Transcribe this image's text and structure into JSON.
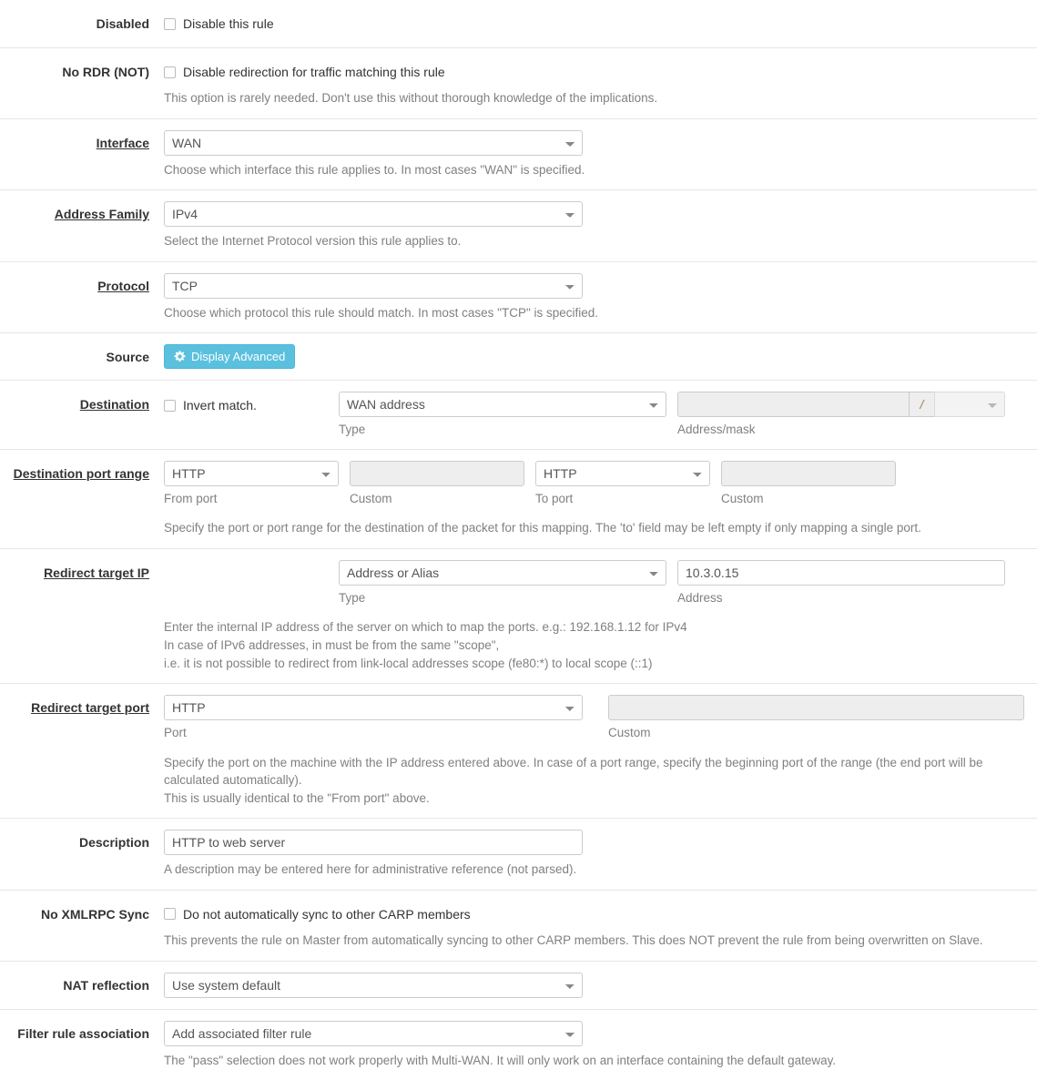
{
  "rows": {
    "disabled": {
      "label": "Disabled",
      "checkbox_label": "Disable this rule",
      "checked": false
    },
    "no_rdr": {
      "label": "No RDR (NOT)",
      "checkbox_label": "Disable redirection for traffic matching this rule",
      "checked": false,
      "help": "This option is rarely needed. Don't use this without thorough knowledge of the implications."
    },
    "interface": {
      "label": "Interface",
      "value": "WAN",
      "help": "Choose which interface this rule applies to. In most cases \"WAN\" is specified."
    },
    "address_family": {
      "label": "Address Family",
      "value": "IPv4",
      "help": "Select the Internet Protocol version this rule applies to."
    },
    "protocol": {
      "label": "Protocol",
      "value": "TCP",
      "help": "Choose which protocol this rule should match. In most cases \"TCP\" is specified."
    },
    "source": {
      "label": "Source",
      "button_label": "Display Advanced",
      "button_icon": "gear-icon",
      "button_color": "#5bc0de"
    },
    "destination": {
      "label": "Destination",
      "invert_label": "Invert match.",
      "invert_checked": false,
      "type_value": "WAN address",
      "type_sublabel": "Type",
      "address_value": "",
      "address_sublabel": "Address/mask",
      "mask_separator": "/",
      "mask_value": "",
      "address_disabled": true
    },
    "destination_port_range": {
      "label": "Destination port range",
      "from_port_value": "HTTP",
      "from_port_sublabel": "From port",
      "from_custom_value": "",
      "from_custom_sublabel": "Custom",
      "from_custom_disabled": true,
      "to_port_value": "HTTP",
      "to_port_sublabel": "To port",
      "to_custom_value": "",
      "to_custom_sublabel": "Custom",
      "to_custom_disabled": true,
      "help": "Specify the port or port range for the destination of the packet for this mapping. The 'to' field may be left empty if only mapping a single port."
    },
    "redirect_target_ip": {
      "label": "Redirect target IP",
      "type_value": "Address or Alias",
      "type_sublabel": "Type",
      "address_value": "10.3.0.15",
      "address_sublabel": "Address",
      "help_line1": "Enter the internal IP address of the server on which to map the ports. e.g.: 192.168.1.12 for IPv4",
      "help_line2": "In case of IPv6 addresses, in must be from the same \"scope\",",
      "help_line3": "i.e. it is not possible to redirect from link-local addresses scope (fe80:*) to local scope (::1)"
    },
    "redirect_target_port": {
      "label": "Redirect target port",
      "port_value": "HTTP",
      "port_sublabel": "Port",
      "custom_value": "",
      "custom_sublabel": "Custom",
      "custom_disabled": true,
      "help_line1": "Specify the port on the machine with the IP address entered above. In case of a port range, specify the beginning port of the range (the end port will be calculated automatically).",
      "help_line2": "This is usually identical to the \"From port\" above."
    },
    "description": {
      "label": "Description",
      "value": "HTTP to web server",
      "help": "A description may be entered here for administrative reference (not parsed)."
    },
    "no_xmlrpc_sync": {
      "label": "No XMLRPC Sync",
      "checkbox_label": "Do not automatically sync to other CARP members",
      "checked": false,
      "help": "This prevents the rule on Master from automatically syncing to other CARP members. This does NOT prevent the rule from being overwritten on Slave."
    },
    "nat_reflection": {
      "label": "NAT reflection",
      "value": "Use system default"
    },
    "filter_rule_association": {
      "label": "Filter rule association",
      "value": "Add associated filter rule",
      "help": "The \"pass\" selection does not work properly with Multi-WAN. It will only work on an interface containing the default gateway."
    }
  }
}
